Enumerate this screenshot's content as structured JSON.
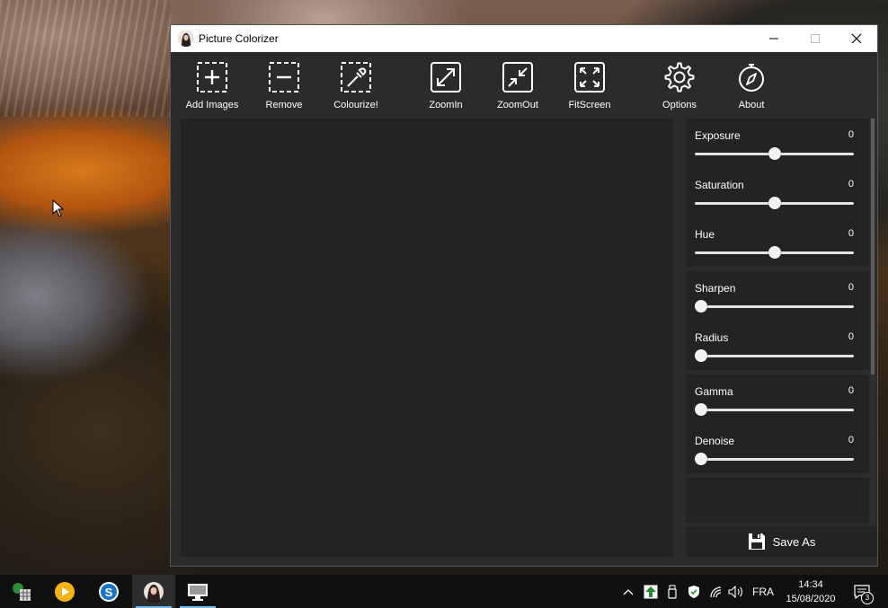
{
  "window": {
    "title": "Picture Colorizer"
  },
  "toolbar": {
    "items": [
      {
        "label": "Add Images",
        "icon": "add-images-icon"
      },
      {
        "label": "Remove",
        "icon": "remove-icon"
      },
      {
        "label": "Colourize!",
        "icon": "colourize-icon"
      },
      {
        "label": "ZoomIn",
        "icon": "zoom-in-icon"
      },
      {
        "label": "ZoomOut",
        "icon": "zoom-out-icon"
      },
      {
        "label": "FitScreen",
        "icon": "fit-screen-icon"
      },
      {
        "label": "Options",
        "icon": "gear-icon"
      },
      {
        "label": "About",
        "icon": "compass-icon"
      }
    ]
  },
  "adjustments": {
    "group1": [
      {
        "label": "Exposure",
        "value": "0",
        "level": 0.5
      },
      {
        "label": "Saturation",
        "value": "0",
        "level": 0.5
      },
      {
        "label": "Hue",
        "value": "0",
        "level": 0.5
      }
    ],
    "group2": [
      {
        "label": "Sharpen",
        "value": "0",
        "level": 0
      },
      {
        "label": "Radius",
        "value": "0",
        "level": 0
      }
    ],
    "group3": [
      {
        "label": "Gamma",
        "value": "0",
        "level": 0
      },
      {
        "label": "Denoise",
        "value": "0",
        "level": 0
      }
    ]
  },
  "save": {
    "label": "Save As",
    "icon": "floppy-disk-icon"
  },
  "taskbar": {
    "language": "FRA",
    "time": "14:34",
    "date": "15/08/2020",
    "notification_count": "3"
  },
  "colors": {
    "window_bg": "#2b2b2b",
    "panel_bg": "#232323",
    "text": "#ffffff",
    "taskbar_bg": "#101010",
    "taskbar_accent": "#76b9ed"
  }
}
